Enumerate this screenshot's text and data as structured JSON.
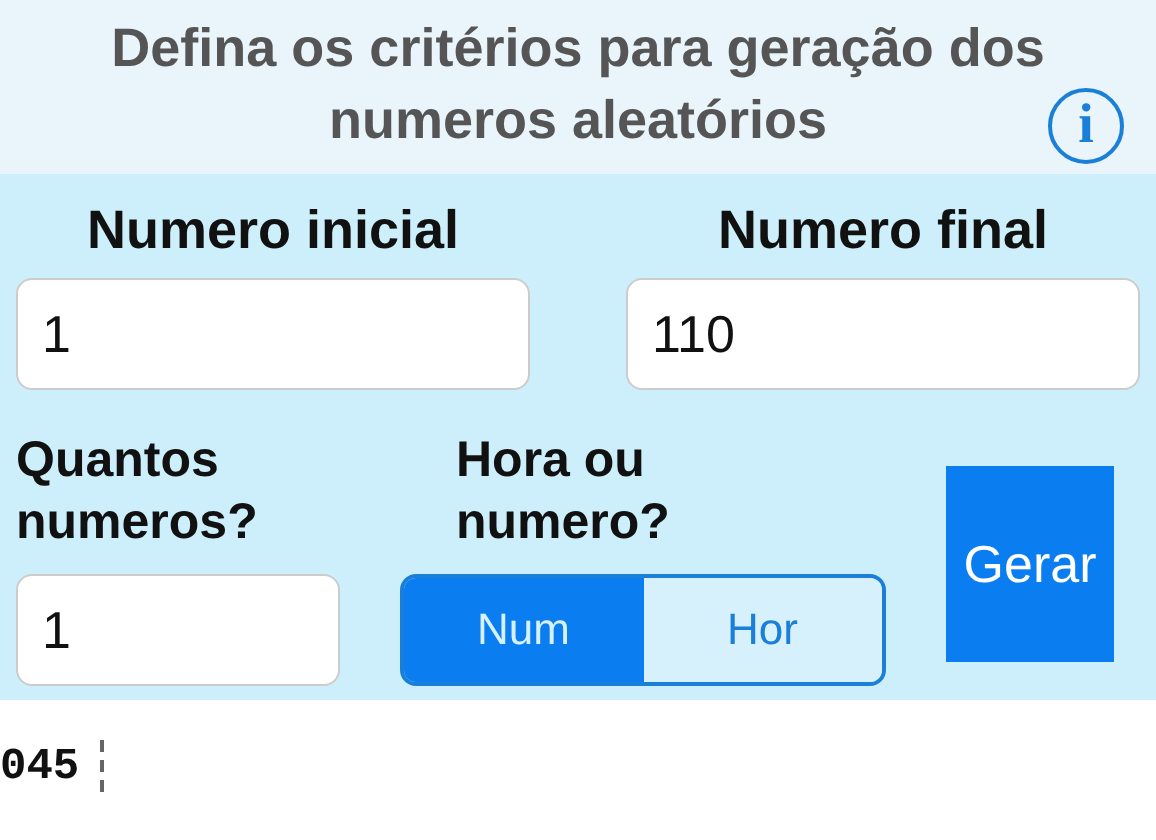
{
  "header": {
    "title_line_1": "Defina os critérios para geração dos",
    "title_line_2": "numeros aleatórios",
    "info_icon": "i"
  },
  "fields": [
    {
      "label": "Numero inicial",
      "value": "1"
    },
    {
      "label": "Numero final",
      "value": "110"
    }
  ],
  "count": {
    "label": "Quantos numeros?",
    "value": "1"
  },
  "mode": {
    "label": "Hora ou numero?",
    "options": [
      {
        "label": "Num",
        "selected": true
      },
      {
        "label": "Hor",
        "selected": false
      }
    ]
  },
  "generate_button": "Gerar",
  "result": "045"
}
